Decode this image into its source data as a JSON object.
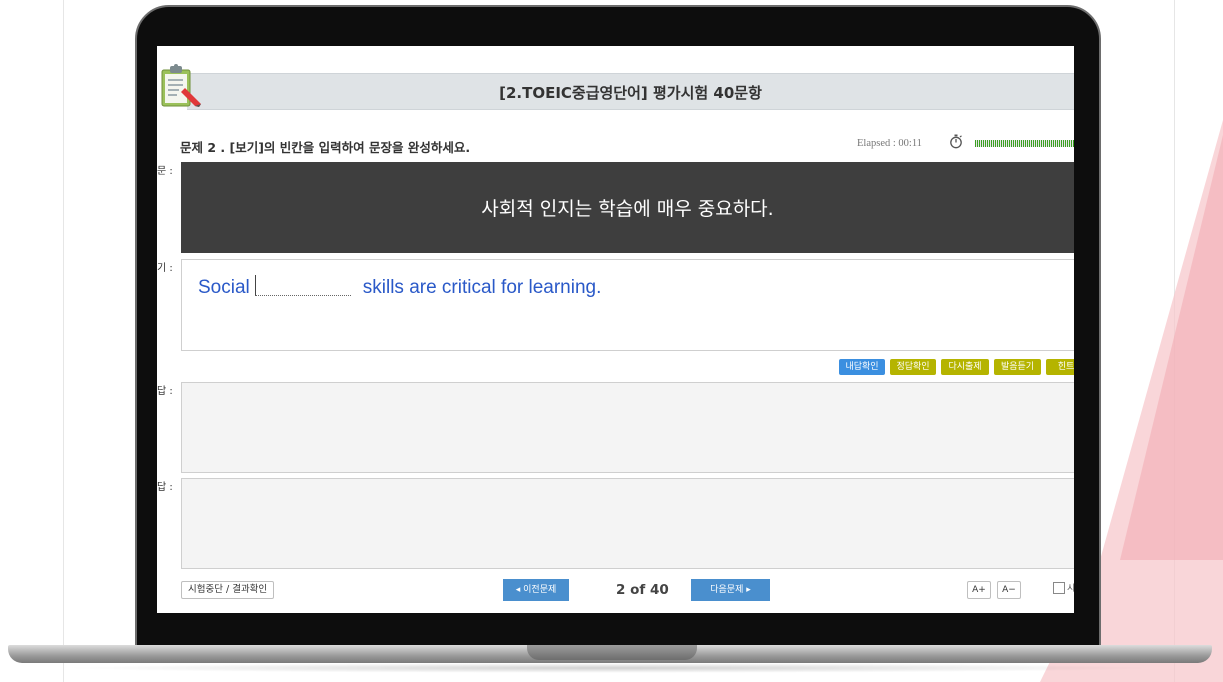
{
  "page_title": "[2.TOEIC중급영단어] 평가시험 40문항",
  "question": {
    "label": "문제 2 . [보기]의 빈칸을 입력하여 문장을 완성하세요.",
    "elapsed": "Elapsed : 00:11",
    "korean_sentence": "사회적 인지는 학습에 매우 중요하다.",
    "english_before": "Social",
    "english_after": "skills are critical for learning."
  },
  "side_labels": {
    "prompt": "문 :",
    "example": "기 :",
    "my_answer": "답 :",
    "correct_answer": "답 :"
  },
  "action_buttons": [
    {
      "label": "내답확인",
      "color": "#3b8fe0"
    },
    {
      "label": "정답확인",
      "color": "#b5b400"
    },
    {
      "label": "다시출제",
      "color": "#b5b400"
    },
    {
      "label": "발음듣기",
      "color": "#b5b400"
    },
    {
      "label": "힌트",
      "color": "#b5b400"
    }
  ],
  "footer": {
    "stop_button": "시험중단 / 결과확인",
    "prev_button": "◂ 이전문제",
    "page_indicator": "2 of 40",
    "next_button": "다음문제 ▸",
    "font_up": "A+",
    "font_down": "A−",
    "checkbox_label": "시"
  },
  "icons": {
    "clipboard": "clipboard-pencil-icon",
    "timer": "stopwatch-icon"
  },
  "colors": {
    "accent_red": "#f4b8be",
    "korean_box": "#3e3e3e",
    "english_text": "#2a59c8",
    "progress_green": "#3aa022",
    "nav_blue": "#4a8fce"
  }
}
